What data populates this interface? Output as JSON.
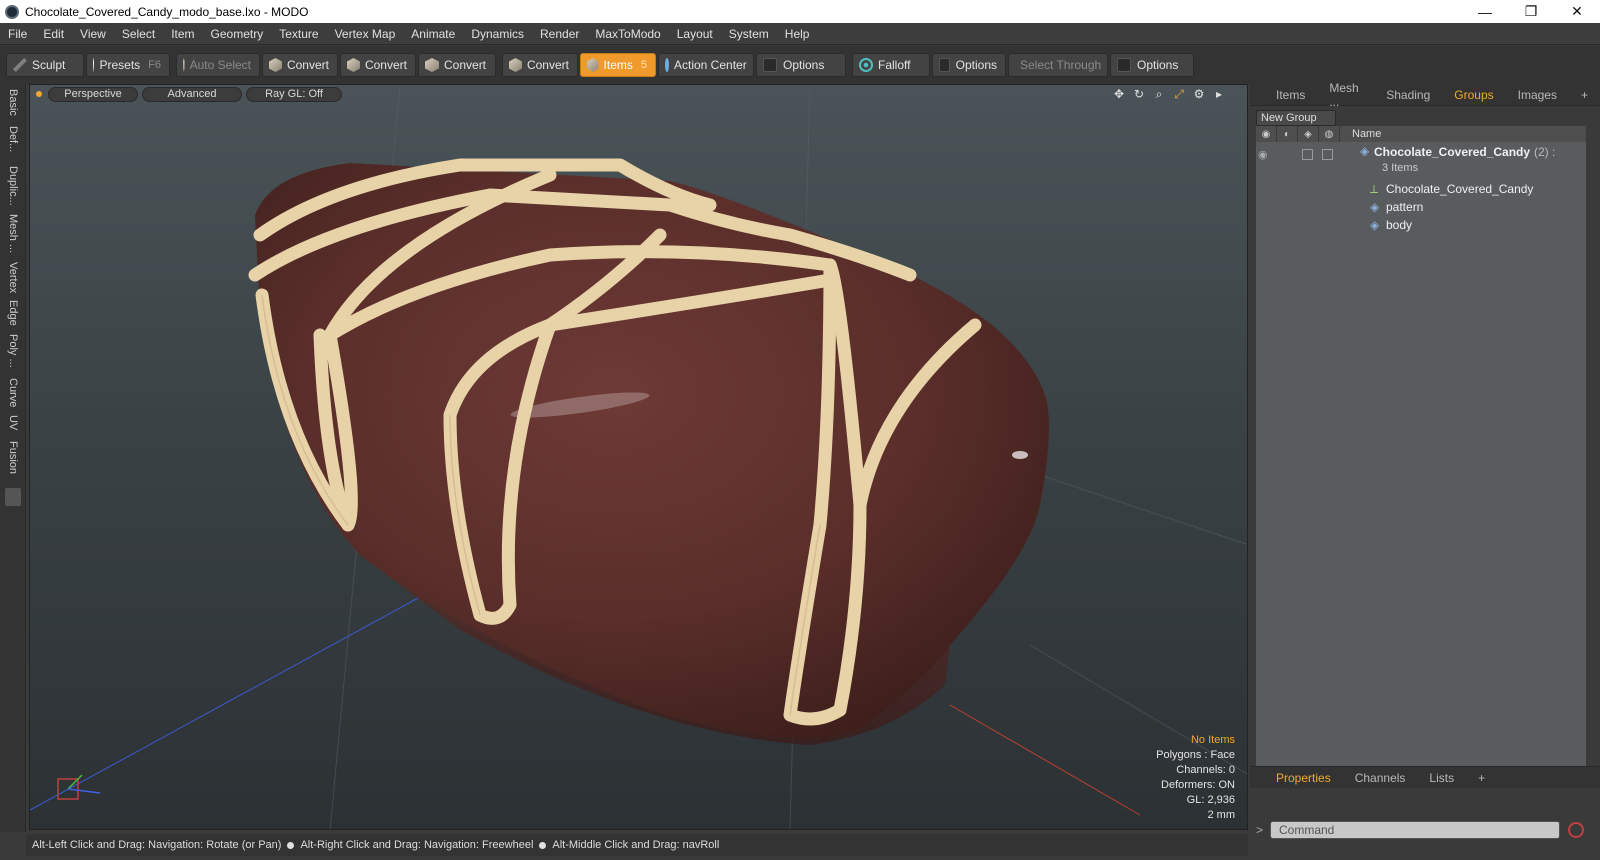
{
  "window": {
    "title": "Chocolate_Covered_Candy_modo_base.lxo - MODO",
    "minimize": "—",
    "maximize": "❐",
    "close": "✕"
  },
  "menu": [
    "File",
    "Edit",
    "View",
    "Select",
    "Item",
    "Geometry",
    "Texture",
    "Vertex Map",
    "Animate",
    "Dynamics",
    "Render",
    "MaxToModo",
    "Layout",
    "System",
    "Help"
  ],
  "toolbar": {
    "sculpt": "Sculpt",
    "presets": "Presets",
    "presets_key": "F6",
    "auto_select": "Auto Select",
    "convert": "Convert",
    "items": "Items",
    "items_key": "5",
    "action_center": "Action Center",
    "options": "Options",
    "falloff": "Falloff",
    "select_through": "Select Through"
  },
  "left_tabs": [
    "Basic",
    "Def...",
    "Duplic...",
    "Mesh ...",
    "Vertex",
    "Edge",
    "Poly ...",
    "Curve",
    "UV",
    "Fusion"
  ],
  "viewport": {
    "view": "Perspective",
    "mode": "Advanced",
    "raygl": "Ray GL: Off",
    "info": {
      "no_items": "No Items",
      "polygons": "Polygons : Face",
      "channels": "Channels: 0",
      "deformers": "Deformers: ON",
      "gl": "GL: 2,936",
      "scale": "2 mm"
    }
  },
  "status": {
    "part1": "Alt-Left Click and Drag: Navigation: Rotate (or Pan)",
    "part2": "Alt-Right Click and Drag: Navigation: Freewheel",
    "part3": "Alt-Middle Click and Drag: navRoll"
  },
  "right_panel": {
    "tabs": [
      "Items",
      "Mesh ...",
      "Shading",
      "Groups",
      "Images"
    ],
    "active_tab": "Groups",
    "new_group": "New Group",
    "column_name": "Name",
    "group": {
      "name": "Chocolate_Covered_Candy",
      "count": "(2) :",
      "sub": "3 Items"
    },
    "children": [
      "Chocolate_Covered_Candy",
      "pattern",
      "body"
    ]
  },
  "bottom_panel": {
    "tabs": [
      "Properties",
      "Channels",
      "Lists"
    ],
    "command_placeholder": "Command"
  },
  "colors": {
    "accent": "#f0a830",
    "chocolate": "#5a2e2a",
    "drizzle": "#e8d3a8"
  }
}
